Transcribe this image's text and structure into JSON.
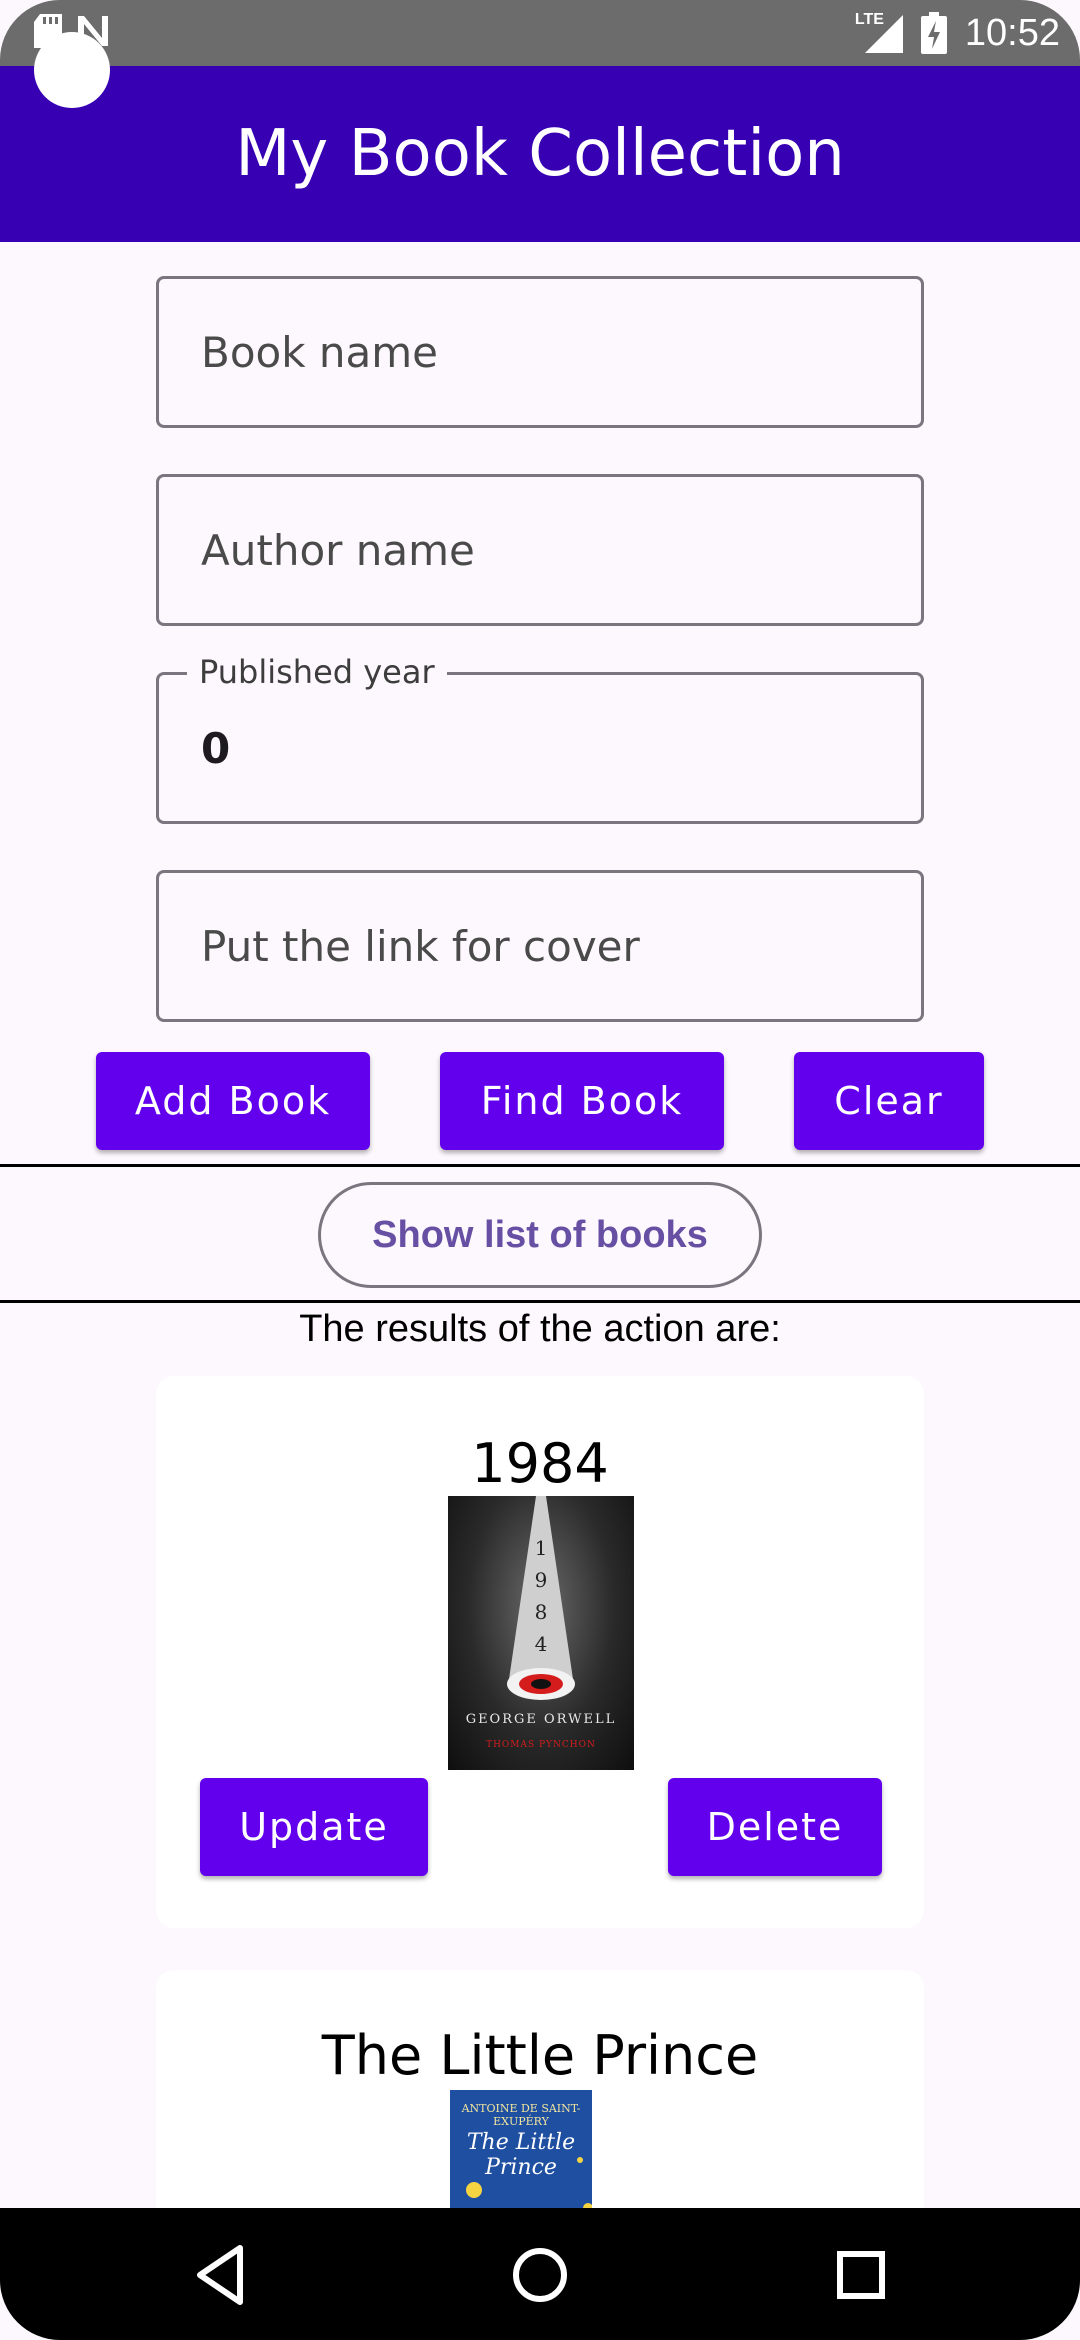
{
  "status_bar": {
    "time": "10:52",
    "network": "LTE",
    "left_icons": [
      "sd-card-icon",
      "n-icon"
    ],
    "right_icons": [
      "signal-icon",
      "battery-icon"
    ]
  },
  "app_bar": {
    "title": "My Book Collection"
  },
  "form": {
    "book_name": {
      "placeholder": "Book name",
      "value": ""
    },
    "author_name": {
      "placeholder": "Author name",
      "value": ""
    },
    "published_year": {
      "label": "Published year",
      "value": "0"
    },
    "cover_link": {
      "placeholder": "Put the link for cover",
      "value": ""
    }
  },
  "actions": {
    "add_label": "Add Book",
    "find_label": "Find Book",
    "clear_label": "Clear",
    "show_list_label": "Show list of books"
  },
  "results": {
    "label": "The results of the action are:",
    "books": [
      {
        "title": "1984",
        "cover_text": {
          "vertical": [
            "1",
            "9",
            "8",
            "4"
          ],
          "author": "GEORGE ORWELL",
          "foreword": "THOMAS PYNCHON"
        },
        "update_label": "Update",
        "delete_label": "Delete"
      },
      {
        "title": "The Little Prince",
        "cover_text": {
          "author": "ANTOINE DE SAINT-EXUPÉRY",
          "title": "The Little Prince"
        }
      }
    ]
  },
  "colors": {
    "primary": "#6200ee",
    "app_bar": "#3700b3",
    "outline_text": "#6750a4",
    "background": "#fdf8fd"
  },
  "nav_bar": {
    "icons": [
      "back-icon",
      "home-icon",
      "recents-icon"
    ]
  }
}
